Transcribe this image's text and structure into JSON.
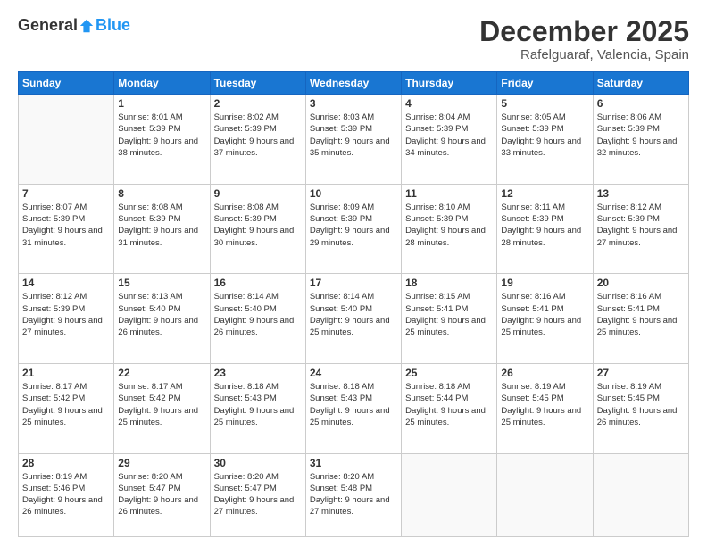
{
  "header": {
    "logo_general": "General",
    "logo_blue": "Blue",
    "month_title": "December 2025",
    "location": "Rafelguaraf, Valencia, Spain"
  },
  "weekdays": [
    "Sunday",
    "Monday",
    "Tuesday",
    "Wednesday",
    "Thursday",
    "Friday",
    "Saturday"
  ],
  "weeks": [
    [
      {
        "day": "",
        "sunrise": "",
        "sunset": "",
        "daylight": ""
      },
      {
        "day": "1",
        "sunrise": "Sunrise: 8:01 AM",
        "sunset": "Sunset: 5:39 PM",
        "daylight": "Daylight: 9 hours and 38 minutes."
      },
      {
        "day": "2",
        "sunrise": "Sunrise: 8:02 AM",
        "sunset": "Sunset: 5:39 PM",
        "daylight": "Daylight: 9 hours and 37 minutes."
      },
      {
        "day": "3",
        "sunrise": "Sunrise: 8:03 AM",
        "sunset": "Sunset: 5:39 PM",
        "daylight": "Daylight: 9 hours and 35 minutes."
      },
      {
        "day": "4",
        "sunrise": "Sunrise: 8:04 AM",
        "sunset": "Sunset: 5:39 PM",
        "daylight": "Daylight: 9 hours and 34 minutes."
      },
      {
        "day": "5",
        "sunrise": "Sunrise: 8:05 AM",
        "sunset": "Sunset: 5:39 PM",
        "daylight": "Daylight: 9 hours and 33 minutes."
      },
      {
        "day": "6",
        "sunrise": "Sunrise: 8:06 AM",
        "sunset": "Sunset: 5:39 PM",
        "daylight": "Daylight: 9 hours and 32 minutes."
      }
    ],
    [
      {
        "day": "7",
        "sunrise": "Sunrise: 8:07 AM",
        "sunset": "Sunset: 5:39 PM",
        "daylight": "Daylight: 9 hours and 31 minutes."
      },
      {
        "day": "8",
        "sunrise": "Sunrise: 8:08 AM",
        "sunset": "Sunset: 5:39 PM",
        "daylight": "Daylight: 9 hours and 31 minutes."
      },
      {
        "day": "9",
        "sunrise": "Sunrise: 8:08 AM",
        "sunset": "Sunset: 5:39 PM",
        "daylight": "Daylight: 9 hours and 30 minutes."
      },
      {
        "day": "10",
        "sunrise": "Sunrise: 8:09 AM",
        "sunset": "Sunset: 5:39 PM",
        "daylight": "Daylight: 9 hours and 29 minutes."
      },
      {
        "day": "11",
        "sunrise": "Sunrise: 8:10 AM",
        "sunset": "Sunset: 5:39 PM",
        "daylight": "Daylight: 9 hours and 28 minutes."
      },
      {
        "day": "12",
        "sunrise": "Sunrise: 8:11 AM",
        "sunset": "Sunset: 5:39 PM",
        "daylight": "Daylight: 9 hours and 28 minutes."
      },
      {
        "day": "13",
        "sunrise": "Sunrise: 8:12 AM",
        "sunset": "Sunset: 5:39 PM",
        "daylight": "Daylight: 9 hours and 27 minutes."
      }
    ],
    [
      {
        "day": "14",
        "sunrise": "Sunrise: 8:12 AM",
        "sunset": "Sunset: 5:39 PM",
        "daylight": "Daylight: 9 hours and 27 minutes."
      },
      {
        "day": "15",
        "sunrise": "Sunrise: 8:13 AM",
        "sunset": "Sunset: 5:40 PM",
        "daylight": "Daylight: 9 hours and 26 minutes."
      },
      {
        "day": "16",
        "sunrise": "Sunrise: 8:14 AM",
        "sunset": "Sunset: 5:40 PM",
        "daylight": "Daylight: 9 hours and 26 minutes."
      },
      {
        "day": "17",
        "sunrise": "Sunrise: 8:14 AM",
        "sunset": "Sunset: 5:40 PM",
        "daylight": "Daylight: 9 hours and 25 minutes."
      },
      {
        "day": "18",
        "sunrise": "Sunrise: 8:15 AM",
        "sunset": "Sunset: 5:41 PM",
        "daylight": "Daylight: 9 hours and 25 minutes."
      },
      {
        "day": "19",
        "sunrise": "Sunrise: 8:16 AM",
        "sunset": "Sunset: 5:41 PM",
        "daylight": "Daylight: 9 hours and 25 minutes."
      },
      {
        "day": "20",
        "sunrise": "Sunrise: 8:16 AM",
        "sunset": "Sunset: 5:41 PM",
        "daylight": "Daylight: 9 hours and 25 minutes."
      }
    ],
    [
      {
        "day": "21",
        "sunrise": "Sunrise: 8:17 AM",
        "sunset": "Sunset: 5:42 PM",
        "daylight": "Daylight: 9 hours and 25 minutes."
      },
      {
        "day": "22",
        "sunrise": "Sunrise: 8:17 AM",
        "sunset": "Sunset: 5:42 PM",
        "daylight": "Daylight: 9 hours and 25 minutes."
      },
      {
        "day": "23",
        "sunrise": "Sunrise: 8:18 AM",
        "sunset": "Sunset: 5:43 PM",
        "daylight": "Daylight: 9 hours and 25 minutes."
      },
      {
        "day": "24",
        "sunrise": "Sunrise: 8:18 AM",
        "sunset": "Sunset: 5:43 PM",
        "daylight": "Daylight: 9 hours and 25 minutes."
      },
      {
        "day": "25",
        "sunrise": "Sunrise: 8:18 AM",
        "sunset": "Sunset: 5:44 PM",
        "daylight": "Daylight: 9 hours and 25 minutes."
      },
      {
        "day": "26",
        "sunrise": "Sunrise: 8:19 AM",
        "sunset": "Sunset: 5:45 PM",
        "daylight": "Daylight: 9 hours and 25 minutes."
      },
      {
        "day": "27",
        "sunrise": "Sunrise: 8:19 AM",
        "sunset": "Sunset: 5:45 PM",
        "daylight": "Daylight: 9 hours and 26 minutes."
      }
    ],
    [
      {
        "day": "28",
        "sunrise": "Sunrise: 8:19 AM",
        "sunset": "Sunset: 5:46 PM",
        "daylight": "Daylight: 9 hours and 26 minutes."
      },
      {
        "day": "29",
        "sunrise": "Sunrise: 8:20 AM",
        "sunset": "Sunset: 5:47 PM",
        "daylight": "Daylight: 9 hours and 26 minutes."
      },
      {
        "day": "30",
        "sunrise": "Sunrise: 8:20 AM",
        "sunset": "Sunset: 5:47 PM",
        "daylight": "Daylight: 9 hours and 27 minutes."
      },
      {
        "day": "31",
        "sunrise": "Sunrise: 8:20 AM",
        "sunset": "Sunset: 5:48 PM",
        "daylight": "Daylight: 9 hours and 27 minutes."
      },
      {
        "day": "",
        "sunrise": "",
        "sunset": "",
        "daylight": ""
      },
      {
        "day": "",
        "sunrise": "",
        "sunset": "",
        "daylight": ""
      },
      {
        "day": "",
        "sunrise": "",
        "sunset": "",
        "daylight": ""
      }
    ]
  ]
}
